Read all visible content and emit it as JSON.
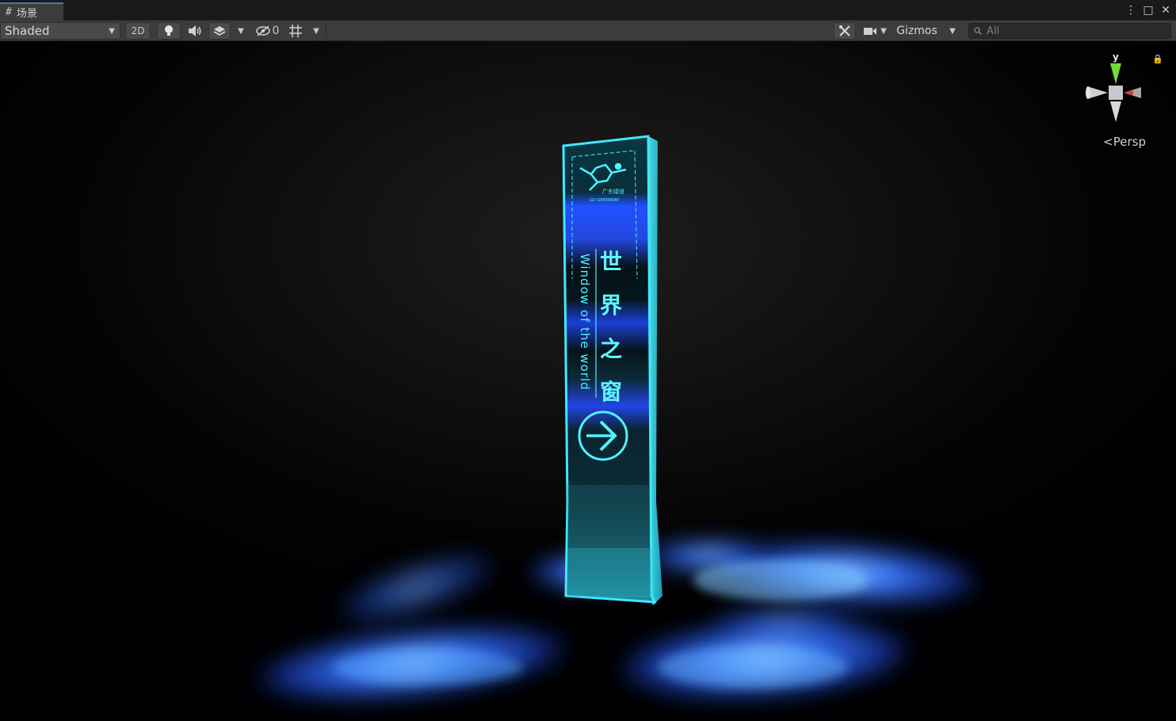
{
  "tab": {
    "icon": "grid-icon",
    "title": "场景"
  },
  "window_controls": {
    "more": "⋮",
    "maximize": "□",
    "close": "✕"
  },
  "toolbar": {
    "draw_mode": "Shaded",
    "mode_2d": "2D",
    "hidden_count": "0",
    "gizmos_label": "Gizmos",
    "search_placeholder": "All"
  },
  "gizmo": {
    "axis_y": "y",
    "projection_label": "Persp"
  },
  "sign": {
    "cn_text": [
      "世",
      "界",
      "之",
      "窗"
    ],
    "en_text": "Window of the world",
    "logo_cn": "广东绿道",
    "logo_en": "GD GREENWAY"
  },
  "colors": {
    "tab_accent": "#3a79bb",
    "toolbar_bg": "#3c3c3c",
    "sign_cyan": "#3ff0ff",
    "light_blue": "#2c63ff",
    "gizmo_y": "#76d936",
    "gizmo_x": "#d8382e"
  }
}
